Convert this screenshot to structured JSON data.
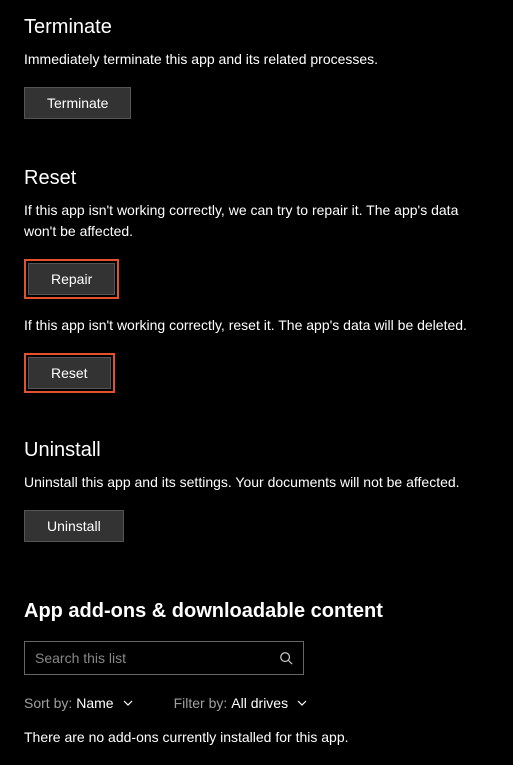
{
  "terminate": {
    "title": "Terminate",
    "desc": "Immediately terminate this app and its related processes.",
    "button": "Terminate"
  },
  "reset": {
    "title": "Reset",
    "repair_desc": "If this app isn't working correctly, we can try to repair it. The app's data won't be affected.",
    "repair_button": "Repair",
    "reset_desc": "If this app isn't working correctly, reset it. The app's data will be deleted.",
    "reset_button": "Reset"
  },
  "uninstall": {
    "title": "Uninstall",
    "desc": "Uninstall this app and its settings. Your documents will not be affected.",
    "button": "Uninstall"
  },
  "addons": {
    "title": "App add-ons & downloadable content",
    "search_placeholder": "Search this list",
    "sort_label": "Sort by:",
    "sort_value": "Name",
    "filter_label": "Filter by:",
    "filter_value": "All drives",
    "empty": "There are no add-ons currently installed for this app."
  }
}
